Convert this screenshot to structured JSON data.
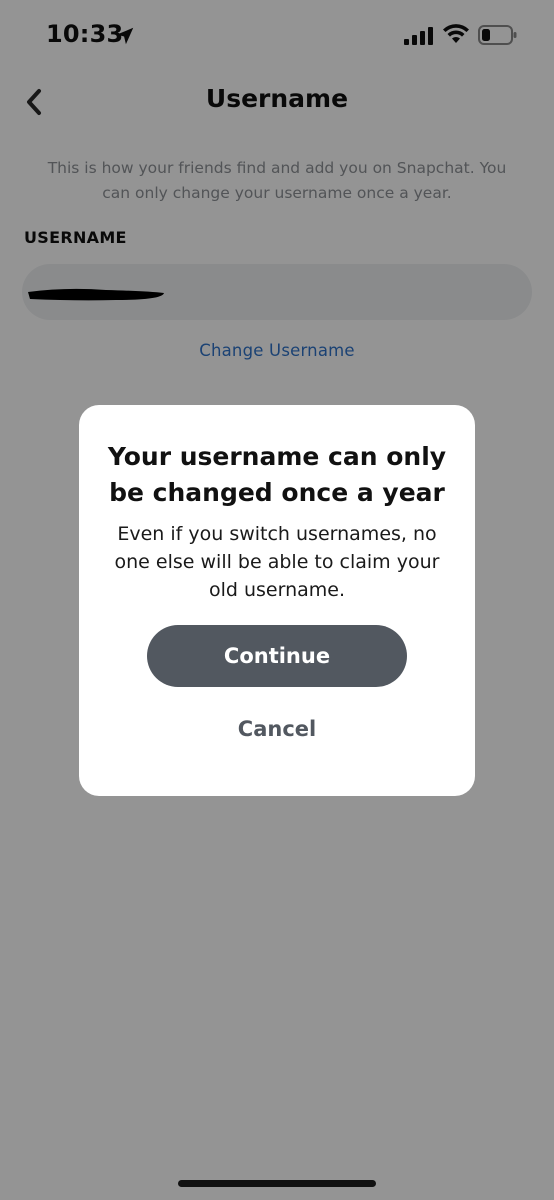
{
  "status_bar": {
    "time": "10:33",
    "icons": [
      "location-arrow-icon",
      "cellular-signal-icon",
      "wifi-icon",
      "battery-low-icon"
    ]
  },
  "header": {
    "title": "Username",
    "back_icon": "chevron-left-icon"
  },
  "description": "This is how your friends find and add you on Snapchat. You can only change your username once a year.",
  "username_field": {
    "label": "USERNAME"
  },
  "change_link": "Change Username",
  "dialog": {
    "title": "Your username can only be changed once a year",
    "body": "Even if you switch usernames, no one else will be able to claim your old username.",
    "continue_label": "Continue",
    "cancel_label": "Cancel"
  },
  "colors": {
    "link": "#2f73c9",
    "button_bg": "#525860",
    "field_bg": "#eef0f2",
    "overlay": "rgba(0,0,0,0.42)"
  }
}
